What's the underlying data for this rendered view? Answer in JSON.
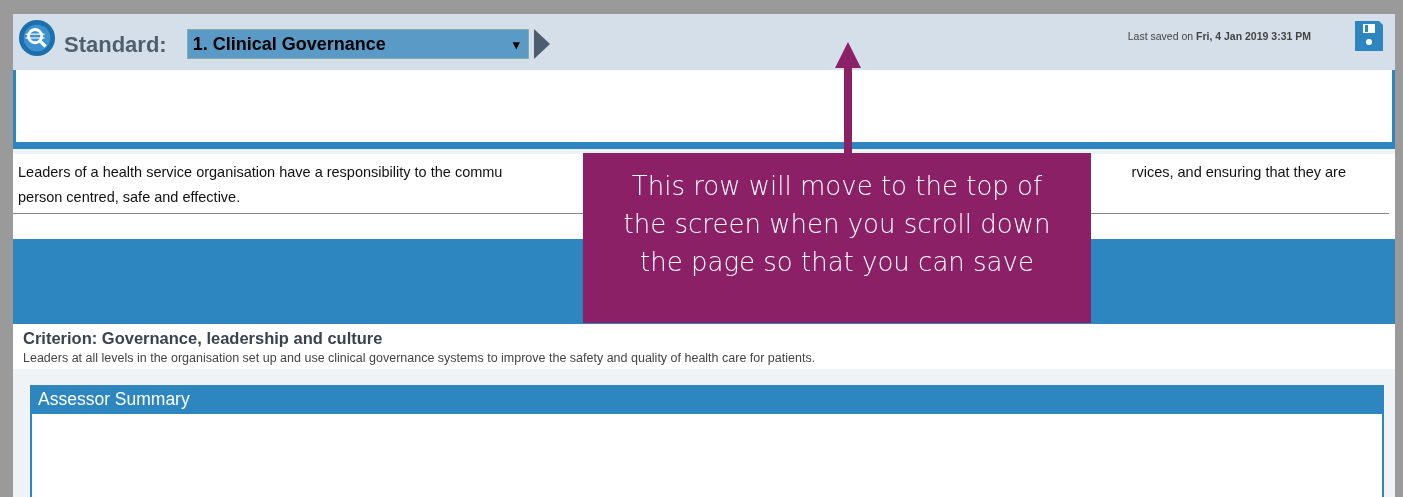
{
  "header": {
    "label": "Standard:",
    "dropdown": {
      "value": "1. Clinical Governance",
      "caret": "▾"
    },
    "last_saved": "Last saved on **Fri, 4 Jan 2019 3:31 PM**"
  },
  "description": {
    "line_1_start": "Leaders of a health service organisation have a responsibility to the commu",
    "line_1_end": "rvices, and ensuring that they are",
    "line_2": "person centred, safe and effective."
  },
  "criterion": {
    "title": "Criterion: Governance, leadership and culture",
    "text": "Leaders at all levels in the organisation set up and use clinical governance systems to improve the safety and quality of health care for patients."
  },
  "assessor_summary": {
    "title": "Assessor Summary"
  },
  "callout": {
    "text": "This row will move to the top of the screen when you scroll down the page so that you can save"
  }
}
